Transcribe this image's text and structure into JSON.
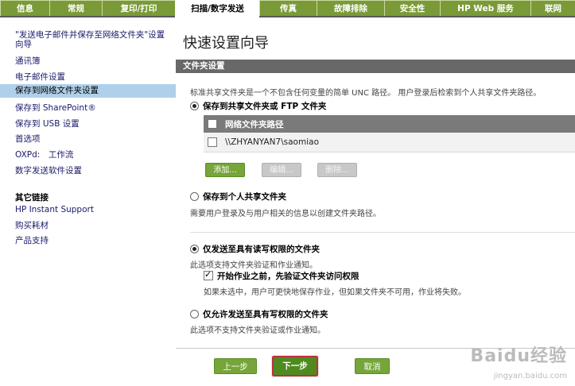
{
  "tabs": [
    {
      "label": "信息",
      "active": false
    },
    {
      "label": "常规",
      "active": false
    },
    {
      "label": "复印/打印",
      "active": false
    },
    {
      "label": "扫描/数字发送",
      "active": true
    },
    {
      "label": "传真",
      "active": false
    },
    {
      "label": "故障排除",
      "active": false
    },
    {
      "label": "安全性",
      "active": false
    },
    {
      "label": "HP Web 服务",
      "active": false
    },
    {
      "label": "联网",
      "active": false
    }
  ],
  "sidebar": {
    "items": [
      {
        "label": "\"发送电子邮件并保存至网络文件夹\"设置向导",
        "selected": false
      },
      {
        "label": "通讯簿",
        "selected": false
      },
      {
        "label": "电子邮件设置",
        "selected": false
      },
      {
        "label": "保存到网络文件夹设置",
        "selected": true
      },
      {
        "label": "保存到 SharePoint®",
        "selected": false
      },
      {
        "label": "保存到 USB 设置",
        "selected": false
      },
      {
        "label": "首选项",
        "selected": false
      },
      {
        "label": "OXPd:　工作流",
        "selected": false
      },
      {
        "label": "数字发送软件设置",
        "selected": false
      }
    ],
    "other_links_heading": "其它链接",
    "other_links": [
      {
        "label": "HP Instant Support"
      },
      {
        "label": "购买耗材"
      },
      {
        "label": "产品支持"
      }
    ]
  },
  "main": {
    "title": "快速设置向导",
    "section_title": "文件夹设置",
    "section_desc": "标准共享文件夹是一个不包含任何变量的简单 UNC 路径。 用户登录后检索到个人共享文件夹路径。",
    "option_shared": {
      "label": "保存到共享文件夹或 FTP 文件夹",
      "checked": true
    },
    "table": {
      "header": "网络文件夹路径",
      "rows": [
        {
          "path": "\\\\ZHYANYAN7\\saomiao",
          "checked": false
        }
      ]
    },
    "buttons": {
      "add": "添加...",
      "edit": "编辑...",
      "delete": "删除..."
    },
    "option_personal": {
      "label": "保存到个人共享文件夹",
      "checked": false,
      "desc": "需要用户登录及与用户相关的信息以创建文件夹路径。"
    },
    "option_rw": {
      "label": "仅发送至具有读写权限的文件夹",
      "checked": true,
      "desc": "此选项支持文件夹验证和作业通知。"
    },
    "verify": {
      "label": "开始作业之前，先验证文件夹访问权限",
      "checked": true,
      "desc": "如果未选中，用户可更快地保存作业，但如果文件夹不可用，作业将失败。"
    },
    "option_write": {
      "label": "仅允许发送至具有写权限的文件夹",
      "checked": false,
      "desc": "此选项不支持文件夹验证或作业通知。"
    },
    "footer": {
      "prev": "上一步",
      "next": "下一步",
      "cancel": "取消"
    }
  },
  "watermark": {
    "text": "Baidu经验",
    "url": "jingyan.baidu.com"
  }
}
